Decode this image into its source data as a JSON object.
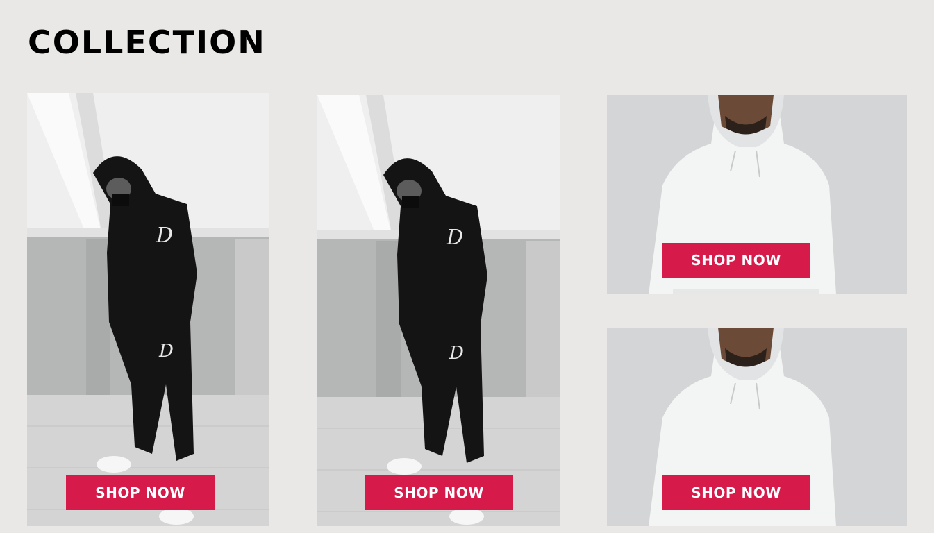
{
  "page": {
    "title": "COLLECTION"
  },
  "products": [
    {
      "id": "p1",
      "image": "black-tracksuit-image",
      "cta": "SHOP NOW"
    },
    {
      "id": "p2",
      "image": "black-tracksuit-image",
      "cta": "SHOP NOW"
    },
    {
      "id": "p3",
      "image": "white-hoodie-image",
      "cta": "SHOP NOW"
    },
    {
      "id": "p4",
      "image": "white-hoodie-image",
      "cta": "SHOP NOW"
    }
  ],
  "colors": {
    "background": "#e9e8e6",
    "accent": "#d61a4a",
    "heading": "#000000"
  }
}
